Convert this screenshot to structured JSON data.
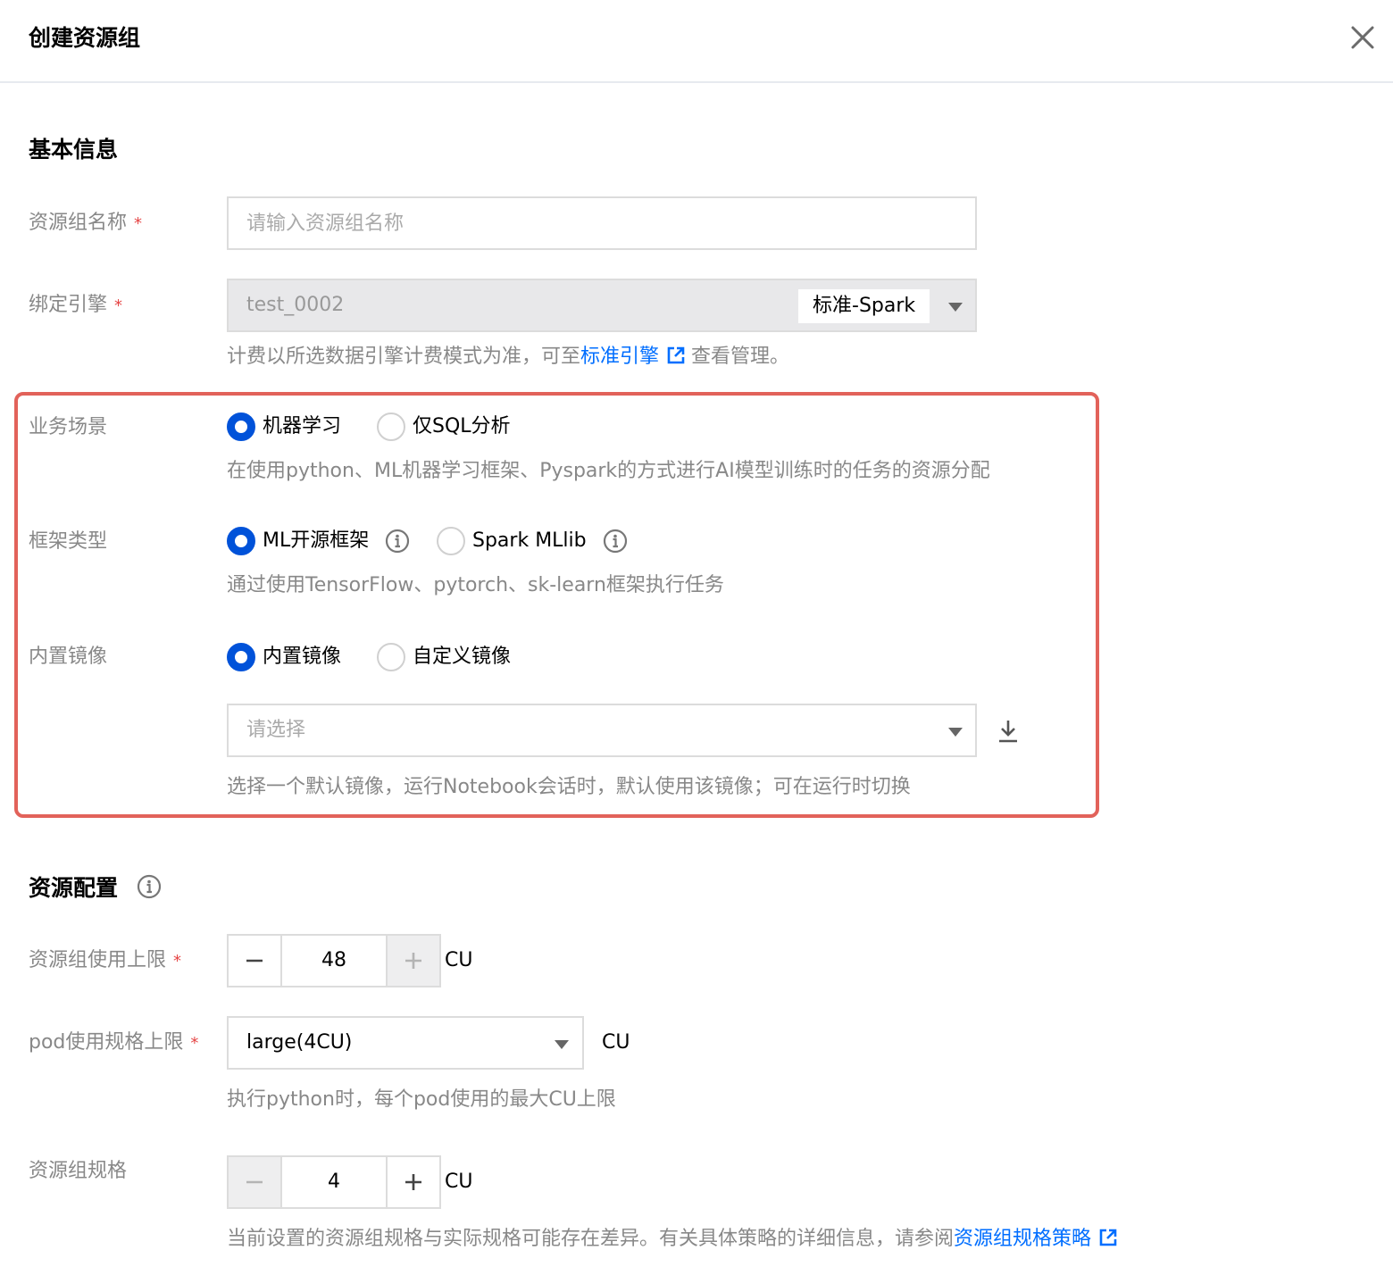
{
  "dialog": {
    "title": "创建资源组"
  },
  "basic": {
    "section_title": "基本信息",
    "name_label": "资源组名称",
    "name_placeholder": "请输入资源组名称",
    "engine_label": "绑定引擎",
    "engine_value": "test_0002",
    "engine_type": "标准-Spark",
    "billing_hint_prefix": "计费以所选数据引擎计费模式为准，可至",
    "billing_hint_link": "标准引擎",
    "billing_hint_suffix": "查看管理。",
    "required_mark": "*"
  },
  "scene": {
    "label": "业务场景",
    "options": [
      {
        "label": "机器学习",
        "selected": true
      },
      {
        "label": "仅SQL分析",
        "selected": false
      }
    ],
    "hint": "在使用python、ML机器学习框架、Pyspark的方式进行AI模型训练时的任务的资源分配"
  },
  "framework": {
    "label": "框架类型",
    "options": [
      {
        "label": "ML开源框架",
        "selected": true
      },
      {
        "label": "Spark MLlib",
        "selected": false
      }
    ],
    "hint": "通过使用TensorFlow、pytorch、sk-learn框架执行任务"
  },
  "image": {
    "label": "内置镜像",
    "options": [
      {
        "label": "内置镜像",
        "selected": true
      },
      {
        "label": "自定义镜像",
        "selected": false
      }
    ],
    "select_placeholder": "请选择",
    "hint": "选择一个默认镜像，运行Notebook会话时，默认使用该镜像；可在运行时切换"
  },
  "resource": {
    "section_title": "资源配置",
    "limit_label": "资源组使用上限",
    "limit_value": "48",
    "limit_unit": "CU",
    "pod_label": "pod使用规格上限",
    "pod_value": "large(4CU)",
    "pod_unit": "CU",
    "pod_hint": "执行python时，每个pod使用的最大CU上限",
    "spec_label": "资源组规格",
    "spec_value": "4",
    "spec_unit": "CU",
    "spec_hint_prefix": "当前设置的资源组规格与实际规格可能存在差异。有关具体策略的详细信息，请参阅",
    "spec_hint_link": "资源组规格策略"
  },
  "colors": {
    "primary": "#0052d9",
    "link": "#006eff",
    "required": "#e54545",
    "highlight_border": "#e2625a",
    "muted_text": "#888888"
  }
}
